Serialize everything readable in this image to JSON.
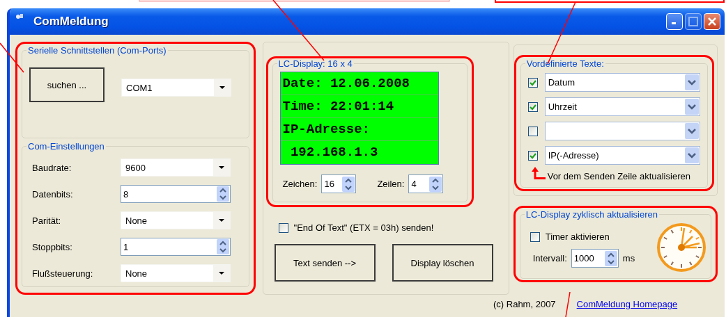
{
  "window": {
    "title": "ComMeldung"
  },
  "ports": {
    "title": "Serielle Schnittstellen (Com-Ports)",
    "search_button": "suchen ...",
    "port": "COM1"
  },
  "settings": {
    "title": "Com-Einstellungen",
    "fields": [
      {
        "label": "Baudrate:",
        "value": "9600",
        "kind": "dropdown"
      },
      {
        "label": "Datenbits:",
        "value": "8",
        "kind": "spinner"
      },
      {
        "label": "Parität:",
        "value": "None",
        "kind": "dropdown"
      },
      {
        "label": "Stoppbits:",
        "value": "1",
        "kind": "spinner"
      },
      {
        "label": "Flußsteuerung:",
        "value": "None",
        "kind": "dropdown"
      }
    ]
  },
  "display": {
    "title": "LC-Display: 16 x 4",
    "lines": [
      "Date: 12.06.2008",
      "Time: 22:01:14",
      "IP-Adresse:",
      " 192.168.1.3"
    ],
    "chars_label": "Zeichen:",
    "chars": "16",
    "rows_label": "Zeilen:",
    "rows": "4"
  },
  "etx": {
    "label": "\"End Of Text\" (ETX = 03h) senden!",
    "checked": false
  },
  "buttons": [
    "Text senden -->",
    "Display löschen"
  ],
  "predefined": {
    "title": "Vordefinierte Texte:",
    "items": [
      {
        "checked": true,
        "value": "Datum"
      },
      {
        "checked": true,
        "value": "Uhrzeit"
      },
      {
        "checked": false
      },
      {
        "checked": true,
        "value": "IP(-Adresse)"
      }
    ],
    "hint": "Vor dem Senden Zeile aktualisieren"
  },
  "cyclic": {
    "title": "LC-Display zyklisch aktualisieren",
    "timer": {
      "label": "Timer aktivieren",
      "checked": false
    },
    "interval_label": "Intervall:",
    "interval": "1000",
    "unit": "ms"
  },
  "footer": {
    "copyright": "(c) Rahm, 2007",
    "link": "ComMeldung Homepage"
  }
}
